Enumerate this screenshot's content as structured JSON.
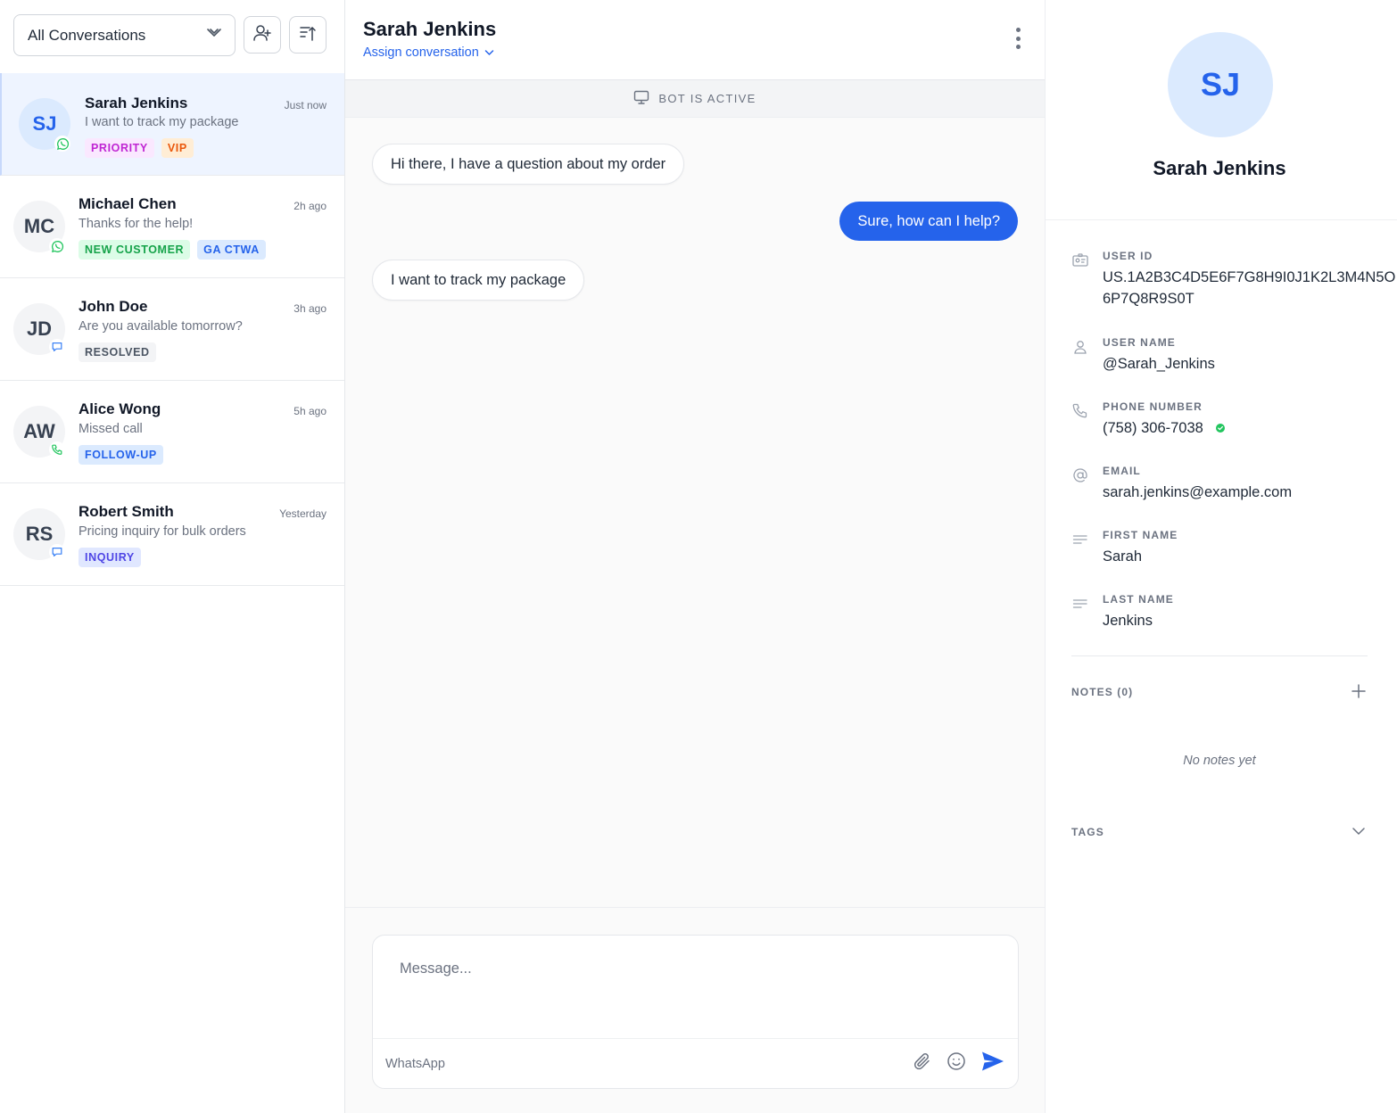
{
  "toolbar": {
    "filter_label": "All Conversations"
  },
  "conversations": [
    {
      "initials": "SJ",
      "name": "Sarah Jenkins",
      "time": "Just now",
      "preview": "I want to track my package",
      "channel": "whatsapp-icon",
      "tags": [
        {
          "label": "PRIORITY",
          "color": "#c026d3",
          "bg": "#fae8ff"
        },
        {
          "label": "VIP",
          "color": "#ea580c",
          "bg": "#ffedd5"
        }
      ]
    },
    {
      "initials": "MC",
      "name": "Michael Chen",
      "time": "2h ago",
      "preview": "Thanks for the help!",
      "channel": "whatsapp-icon",
      "tags": [
        {
          "label": "NEW CUSTOMER",
          "color": "#16a34a",
          "bg": "#dcfce7"
        },
        {
          "label": "GA CTWA",
          "color": "#2563eb",
          "bg": "#dbeafe"
        }
      ]
    },
    {
      "initials": "JD",
      "name": "John Doe",
      "time": "3h ago",
      "preview": "Are you available tomorrow?",
      "channel": "chat-bubble-icon",
      "tags": [
        {
          "label": "RESOLVED",
          "color": "#4b5563",
          "bg": "#f3f4f6"
        }
      ]
    },
    {
      "initials": "AW",
      "name": "Alice Wong",
      "time": "5h ago",
      "preview": "Missed call",
      "channel": "phone-icon",
      "tags": [
        {
          "label": "FOLLOW-UP",
          "color": "#2563eb",
          "bg": "#dbeafe"
        }
      ]
    },
    {
      "initials": "RS",
      "name": "Robert Smith",
      "time": "Yesterday",
      "preview": "Pricing inquiry for bulk orders",
      "channel": "chat-bubble-icon",
      "tags": [
        {
          "label": "INQUIRY",
          "color": "#4f46e5",
          "bg": "#e0e7ff"
        }
      ]
    }
  ],
  "chat": {
    "contact_name": "Sarah Jenkins",
    "assign_label": "Assign conversation",
    "bot_status": "BOT IS ACTIVE",
    "messages": [
      {
        "direction": "in",
        "text": "Hi there, I have a question about my order"
      },
      {
        "direction": "out",
        "text": "Sure, how can I help?"
      },
      {
        "direction": "in",
        "text": "I want to track my package"
      }
    ],
    "composer": {
      "placeholder": "Message...",
      "value": "",
      "channel_label": "WhatsApp"
    }
  },
  "contact": {
    "initials": "SJ",
    "name": "Sarah Jenkins",
    "fields": [
      {
        "label": "USER ID",
        "value": "US.1A2B3C4D5E6F7G8H9I0J1K2L3M4N5O6P7Q8R9S0T",
        "icon": "id-card-icon"
      },
      {
        "label": "USER NAME",
        "value": "@Sarah_Jenkins",
        "icon": "user-icon"
      },
      {
        "label": "PHONE NUMBER",
        "value": "(758) 306-7038",
        "icon": "phone-icon",
        "verified": true
      },
      {
        "label": "EMAIL",
        "value": "sarah.jenkins@example.com",
        "icon": "at-sign-icon"
      },
      {
        "label": "FIRST NAME",
        "value": "Sarah",
        "icon": "text-lines-icon"
      },
      {
        "label": "LAST NAME",
        "value": "Jenkins",
        "icon": "text-lines-icon"
      }
    ],
    "notes_label": "NOTES (0)",
    "no_notes_text": "No notes yet",
    "tags_label": "TAGS"
  },
  "colors": {
    "accent": "#2563eb",
    "active_row": "#eef4ff",
    "whatsapp": "#22c55e",
    "chat_channel": "#3b82f6"
  }
}
